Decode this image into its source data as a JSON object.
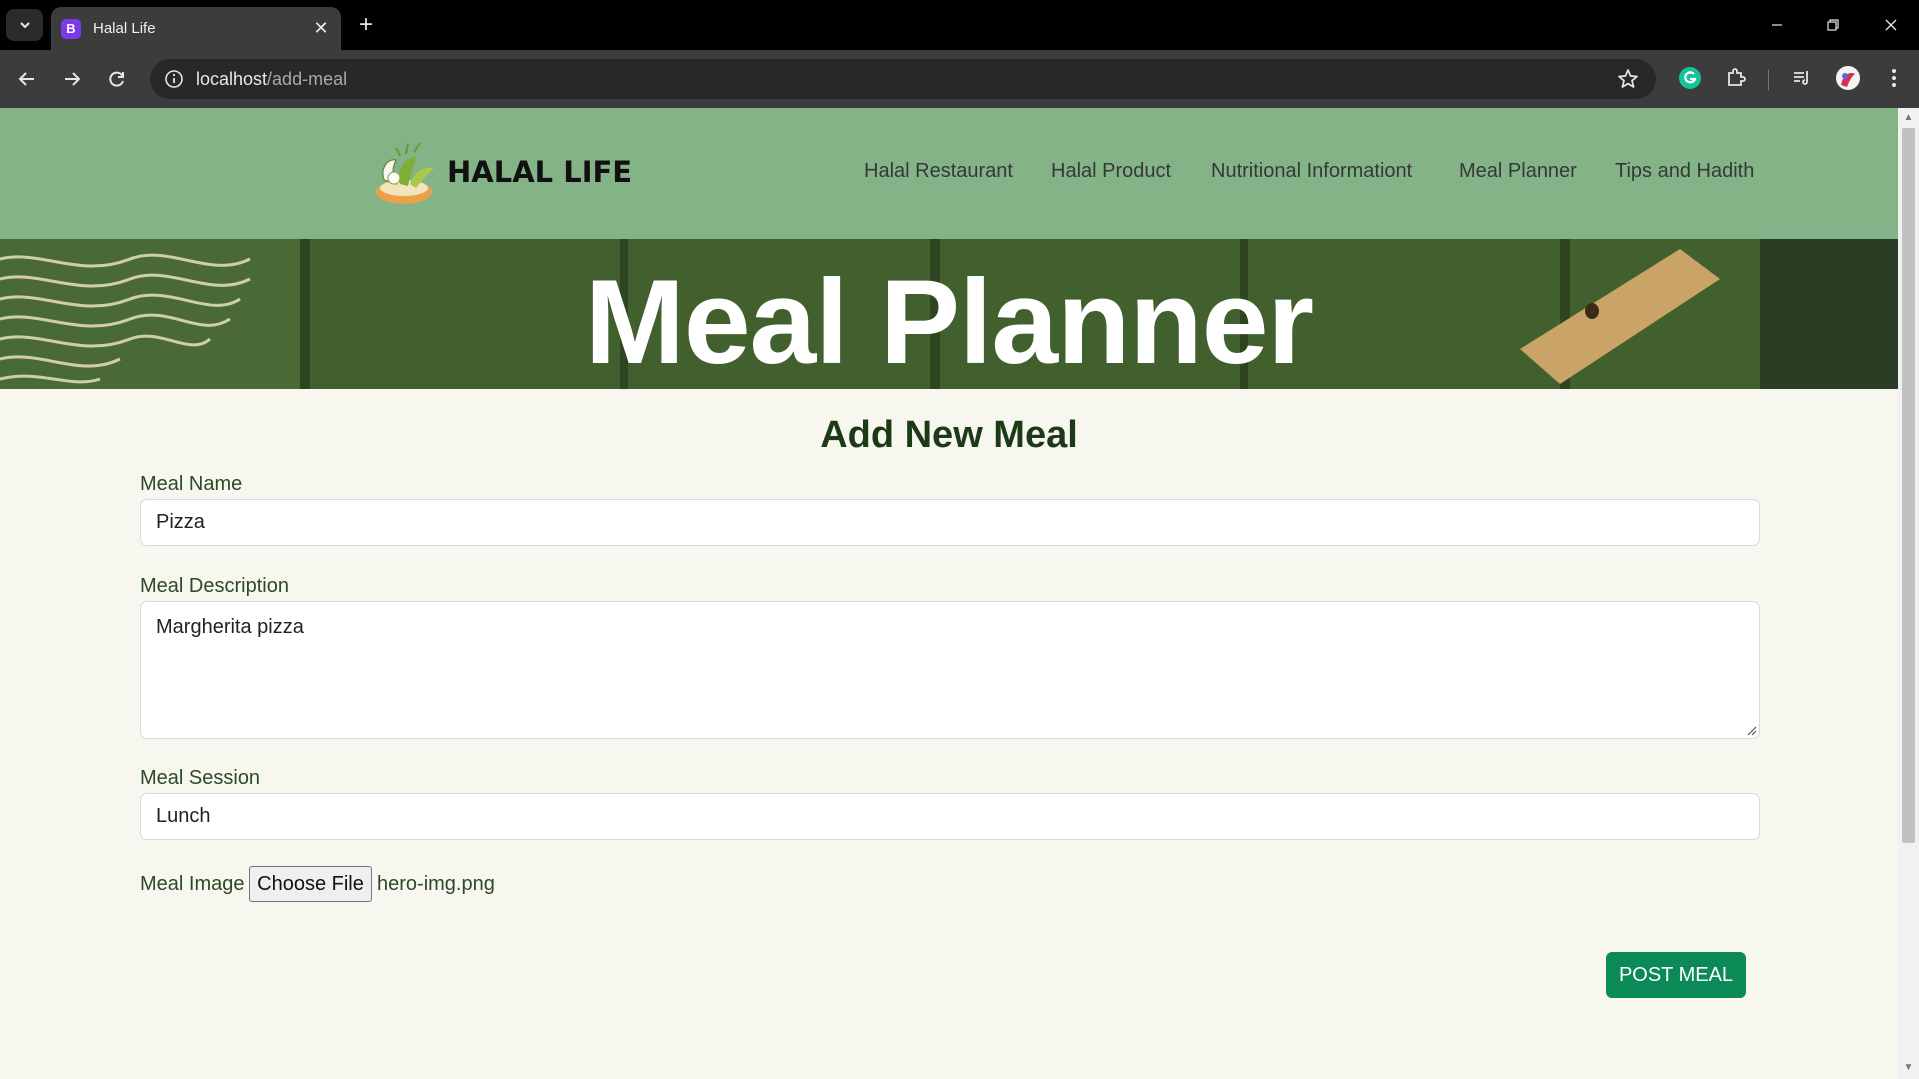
{
  "browser": {
    "tab_title": "Halal Life",
    "favicon_letter": "B",
    "url_host": "localhost",
    "url_path": "/add-meal"
  },
  "site": {
    "brand": "HALAL LIFE",
    "nav": [
      "Halal Restaurant",
      "Halal Product",
      "Nutritional Informationt",
      "Meal Planner",
      "Tips and Hadith"
    ]
  },
  "hero": {
    "title": "Meal Planner"
  },
  "form": {
    "title": "Add New Meal",
    "meal_name_label": "Meal Name",
    "meal_name_value": "Pizza",
    "meal_description_label": "Meal Description",
    "meal_description_value": "Margherita pizza",
    "meal_session_label": "Meal Session",
    "meal_session_value": "Lunch",
    "meal_image_label": "Meal Image",
    "choose_file_label": "Choose File",
    "file_name": "hero-img.png",
    "submit_label": "POST MEAL"
  },
  "colors": {
    "header_bg": "#84b388",
    "hero_bg": "#3e5a2c",
    "page_bg": "#f7f6ef",
    "accent_button": "#0b8a57",
    "heading_text": "#1d3a17"
  }
}
